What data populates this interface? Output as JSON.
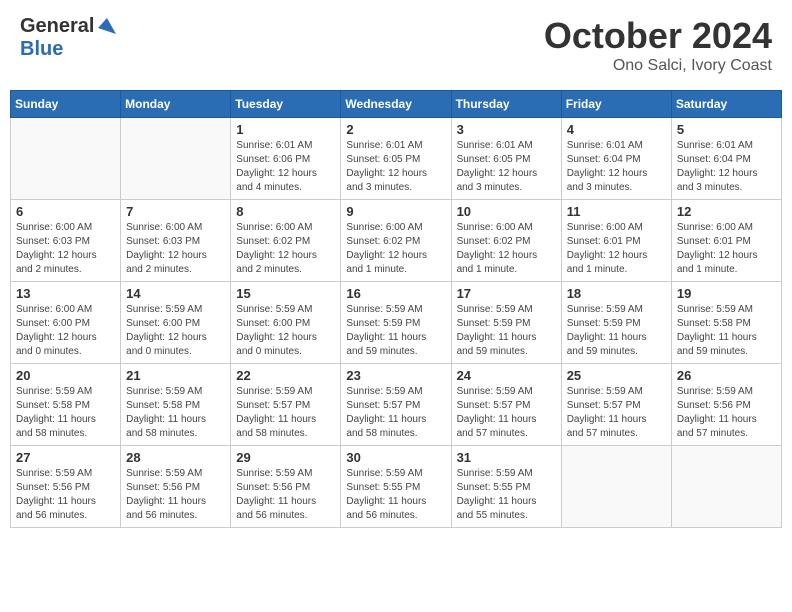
{
  "header": {
    "logo_general": "General",
    "logo_blue": "Blue",
    "month": "October 2024",
    "location": "Ono Salci, Ivory Coast"
  },
  "days_of_week": [
    "Sunday",
    "Monday",
    "Tuesday",
    "Wednesday",
    "Thursday",
    "Friday",
    "Saturday"
  ],
  "weeks": [
    [
      {
        "day": "",
        "detail": ""
      },
      {
        "day": "",
        "detail": ""
      },
      {
        "day": "1",
        "detail": "Sunrise: 6:01 AM\nSunset: 6:06 PM\nDaylight: 12 hours and 4 minutes."
      },
      {
        "day": "2",
        "detail": "Sunrise: 6:01 AM\nSunset: 6:05 PM\nDaylight: 12 hours and 3 minutes."
      },
      {
        "day": "3",
        "detail": "Sunrise: 6:01 AM\nSunset: 6:05 PM\nDaylight: 12 hours and 3 minutes."
      },
      {
        "day": "4",
        "detail": "Sunrise: 6:01 AM\nSunset: 6:04 PM\nDaylight: 12 hours and 3 minutes."
      },
      {
        "day": "5",
        "detail": "Sunrise: 6:01 AM\nSunset: 6:04 PM\nDaylight: 12 hours and 3 minutes."
      }
    ],
    [
      {
        "day": "6",
        "detail": "Sunrise: 6:00 AM\nSunset: 6:03 PM\nDaylight: 12 hours and 2 minutes."
      },
      {
        "day": "7",
        "detail": "Sunrise: 6:00 AM\nSunset: 6:03 PM\nDaylight: 12 hours and 2 minutes."
      },
      {
        "day": "8",
        "detail": "Sunrise: 6:00 AM\nSunset: 6:02 PM\nDaylight: 12 hours and 2 minutes."
      },
      {
        "day": "9",
        "detail": "Sunrise: 6:00 AM\nSunset: 6:02 PM\nDaylight: 12 hours and 1 minute."
      },
      {
        "day": "10",
        "detail": "Sunrise: 6:00 AM\nSunset: 6:02 PM\nDaylight: 12 hours and 1 minute."
      },
      {
        "day": "11",
        "detail": "Sunrise: 6:00 AM\nSunset: 6:01 PM\nDaylight: 12 hours and 1 minute."
      },
      {
        "day": "12",
        "detail": "Sunrise: 6:00 AM\nSunset: 6:01 PM\nDaylight: 12 hours and 1 minute."
      }
    ],
    [
      {
        "day": "13",
        "detail": "Sunrise: 6:00 AM\nSunset: 6:00 PM\nDaylight: 12 hours and 0 minutes."
      },
      {
        "day": "14",
        "detail": "Sunrise: 5:59 AM\nSunset: 6:00 PM\nDaylight: 12 hours and 0 minutes."
      },
      {
        "day": "15",
        "detail": "Sunrise: 5:59 AM\nSunset: 6:00 PM\nDaylight: 12 hours and 0 minutes."
      },
      {
        "day": "16",
        "detail": "Sunrise: 5:59 AM\nSunset: 5:59 PM\nDaylight: 11 hours and 59 minutes."
      },
      {
        "day": "17",
        "detail": "Sunrise: 5:59 AM\nSunset: 5:59 PM\nDaylight: 11 hours and 59 minutes."
      },
      {
        "day": "18",
        "detail": "Sunrise: 5:59 AM\nSunset: 5:59 PM\nDaylight: 11 hours and 59 minutes."
      },
      {
        "day": "19",
        "detail": "Sunrise: 5:59 AM\nSunset: 5:58 PM\nDaylight: 11 hours and 59 minutes."
      }
    ],
    [
      {
        "day": "20",
        "detail": "Sunrise: 5:59 AM\nSunset: 5:58 PM\nDaylight: 11 hours and 58 minutes."
      },
      {
        "day": "21",
        "detail": "Sunrise: 5:59 AM\nSunset: 5:58 PM\nDaylight: 11 hours and 58 minutes."
      },
      {
        "day": "22",
        "detail": "Sunrise: 5:59 AM\nSunset: 5:57 PM\nDaylight: 11 hours and 58 minutes."
      },
      {
        "day": "23",
        "detail": "Sunrise: 5:59 AM\nSunset: 5:57 PM\nDaylight: 11 hours and 58 minutes."
      },
      {
        "day": "24",
        "detail": "Sunrise: 5:59 AM\nSunset: 5:57 PM\nDaylight: 11 hours and 57 minutes."
      },
      {
        "day": "25",
        "detail": "Sunrise: 5:59 AM\nSunset: 5:57 PM\nDaylight: 11 hours and 57 minutes."
      },
      {
        "day": "26",
        "detail": "Sunrise: 5:59 AM\nSunset: 5:56 PM\nDaylight: 11 hours and 57 minutes."
      }
    ],
    [
      {
        "day": "27",
        "detail": "Sunrise: 5:59 AM\nSunset: 5:56 PM\nDaylight: 11 hours and 56 minutes."
      },
      {
        "day": "28",
        "detail": "Sunrise: 5:59 AM\nSunset: 5:56 PM\nDaylight: 11 hours and 56 minutes."
      },
      {
        "day": "29",
        "detail": "Sunrise: 5:59 AM\nSunset: 5:56 PM\nDaylight: 11 hours and 56 minutes."
      },
      {
        "day": "30",
        "detail": "Sunrise: 5:59 AM\nSunset: 5:55 PM\nDaylight: 11 hours and 56 minutes."
      },
      {
        "day": "31",
        "detail": "Sunrise: 5:59 AM\nSunset: 5:55 PM\nDaylight: 11 hours and 55 minutes."
      },
      {
        "day": "",
        "detail": ""
      },
      {
        "day": "",
        "detail": ""
      }
    ]
  ]
}
